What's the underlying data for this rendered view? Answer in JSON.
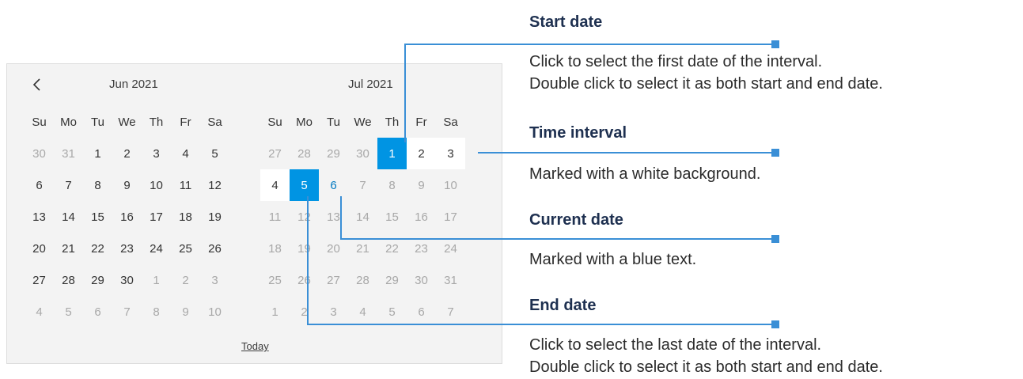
{
  "calendar": {
    "months": [
      {
        "title": "Jun 2021",
        "weekdays": [
          "Su",
          "Mo",
          "Tu",
          "We",
          "Th",
          "Fr",
          "Sa"
        ],
        "days": [
          {
            "t": "30",
            "s": "other"
          },
          {
            "t": "31",
            "s": "other"
          },
          {
            "t": "1",
            "s": ""
          },
          {
            "t": "2",
            "s": ""
          },
          {
            "t": "3",
            "s": ""
          },
          {
            "t": "4",
            "s": ""
          },
          {
            "t": "5",
            "s": ""
          },
          {
            "t": "6",
            "s": ""
          },
          {
            "t": "7",
            "s": ""
          },
          {
            "t": "8",
            "s": ""
          },
          {
            "t": "9",
            "s": ""
          },
          {
            "t": "10",
            "s": ""
          },
          {
            "t": "11",
            "s": ""
          },
          {
            "t": "12",
            "s": ""
          },
          {
            "t": "13",
            "s": ""
          },
          {
            "t": "14",
            "s": ""
          },
          {
            "t": "15",
            "s": ""
          },
          {
            "t": "16",
            "s": ""
          },
          {
            "t": "17",
            "s": ""
          },
          {
            "t": "18",
            "s": ""
          },
          {
            "t": "19",
            "s": ""
          },
          {
            "t": "20",
            "s": ""
          },
          {
            "t": "21",
            "s": ""
          },
          {
            "t": "22",
            "s": ""
          },
          {
            "t": "23",
            "s": ""
          },
          {
            "t": "24",
            "s": ""
          },
          {
            "t": "25",
            "s": ""
          },
          {
            "t": "26",
            "s": ""
          },
          {
            "t": "27",
            "s": ""
          },
          {
            "t": "28",
            "s": ""
          },
          {
            "t": "29",
            "s": ""
          },
          {
            "t": "30",
            "s": ""
          },
          {
            "t": "1",
            "s": "other"
          },
          {
            "t": "2",
            "s": "other"
          },
          {
            "t": "3",
            "s": "other"
          },
          {
            "t": "4",
            "s": "other"
          },
          {
            "t": "5",
            "s": "other"
          },
          {
            "t": "6",
            "s": "other"
          },
          {
            "t": "7",
            "s": "other"
          },
          {
            "t": "8",
            "s": "other"
          },
          {
            "t": "9",
            "s": "other"
          },
          {
            "t": "10",
            "s": "other"
          }
        ]
      },
      {
        "title": "Jul 2021",
        "weekdays": [
          "Su",
          "Mo",
          "Tu",
          "We",
          "Th",
          "Fr",
          "Sa"
        ],
        "days": [
          {
            "t": "27",
            "s": "other"
          },
          {
            "t": "28",
            "s": "other"
          },
          {
            "t": "29",
            "s": "other"
          },
          {
            "t": "30",
            "s": "other"
          },
          {
            "t": "1",
            "s": "sel"
          },
          {
            "t": "2",
            "s": "range"
          },
          {
            "t": "3",
            "s": "range"
          },
          {
            "t": "4",
            "s": "range"
          },
          {
            "t": "5",
            "s": "sel"
          },
          {
            "t": "6",
            "s": "current"
          },
          {
            "t": "7",
            "s": "other"
          },
          {
            "t": "8",
            "s": "other"
          },
          {
            "t": "9",
            "s": "other"
          },
          {
            "t": "10",
            "s": "other"
          },
          {
            "t": "11",
            "s": "other"
          },
          {
            "t": "12",
            "s": "other"
          },
          {
            "t": "13",
            "s": "other"
          },
          {
            "t": "14",
            "s": "other"
          },
          {
            "t": "15",
            "s": "other"
          },
          {
            "t": "16",
            "s": "other"
          },
          {
            "t": "17",
            "s": "other"
          },
          {
            "t": "18",
            "s": "other"
          },
          {
            "t": "19",
            "s": "other"
          },
          {
            "t": "20",
            "s": "other"
          },
          {
            "t": "21",
            "s": "other"
          },
          {
            "t": "22",
            "s": "other"
          },
          {
            "t": "23",
            "s": "other"
          },
          {
            "t": "24",
            "s": "other"
          },
          {
            "t": "25",
            "s": "other"
          },
          {
            "t": "26",
            "s": "other"
          },
          {
            "t": "27",
            "s": "other"
          },
          {
            "t": "28",
            "s": "other"
          },
          {
            "t": "29",
            "s": "other"
          },
          {
            "t": "30",
            "s": "other"
          },
          {
            "t": "31",
            "s": "other"
          },
          {
            "t": "1",
            "s": "other"
          },
          {
            "t": "2",
            "s": "other"
          },
          {
            "t": "3",
            "s": "other"
          },
          {
            "t": "4",
            "s": "other"
          },
          {
            "t": "5",
            "s": "other"
          },
          {
            "t": "6",
            "s": "other"
          },
          {
            "t": "7",
            "s": "other"
          }
        ]
      }
    ],
    "today_label": "Today",
    "prev_icon": "chevron-left-icon"
  },
  "annotations": [
    {
      "title": "Start date",
      "lines": [
        "Click to select the first date of the interval.",
        "Double click to select it as both start and end date."
      ]
    },
    {
      "title": "Time interval",
      "lines": [
        "Marked with a white background."
      ]
    },
    {
      "title": "Current date",
      "lines": [
        "Marked with a blue text."
      ]
    },
    {
      "title": "End date",
      "lines": [
        "Click to select the last date of the interval.",
        "Double click to select it as both start and end date."
      ]
    }
  ],
  "colors": {
    "accent": "#0094e3",
    "leader": "#3a8fd6",
    "current_text": "#0079c1",
    "title": "#1e3050"
  }
}
